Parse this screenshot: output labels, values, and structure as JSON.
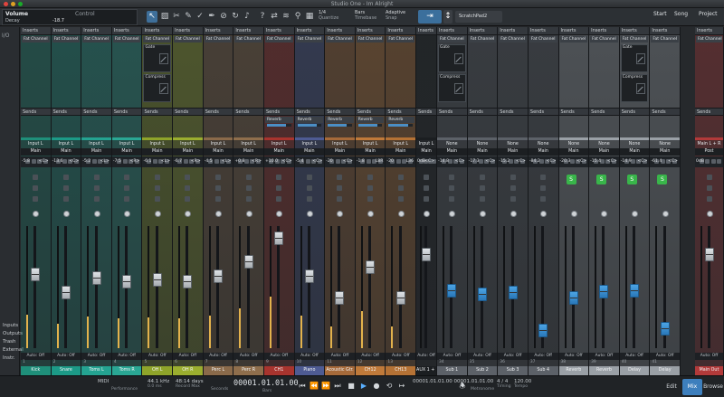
{
  "window": {
    "title": "Studio One - Im Alright"
  },
  "toolbar": {
    "track_name": "Volume",
    "track_sub": "Decay",
    "value": "-18.7",
    "control_label": "Control",
    "quantize_value": "1/4",
    "quantize_label": "Quantize",
    "timebase_value": "Bars",
    "timebase_label": "Timebase",
    "snap_value": "Adaptive",
    "snap_label": "Snap",
    "scratchpad": "ScratchPad2",
    "nav": [
      "Start",
      "Song",
      "Project"
    ],
    "nav_selected": "Song"
  },
  "leftstrip": {
    "io_label": "I/O",
    "menu": [
      "Inputs",
      "Outputs",
      "Trash",
      "External",
      "Instr."
    ]
  },
  "channels": [
    {
      "name": "Kick",
      "num": "1",
      "color": "#1f8f7a",
      "in": "Input L",
      "out": "Main",
      "pan": "<C>",
      "vol": "-5.8",
      "fader": 0.62
    },
    {
      "name": "Snare",
      "num": "2",
      "color": "#1c9a87",
      "in": "Input L",
      "out": "Main",
      "pan": "<C>",
      "vol": "-13.6",
      "fader": 0.45
    },
    {
      "name": "Toms L",
      "num": "3",
      "color": "#24a391",
      "in": "Input L",
      "out": "Main",
      "pan": "<L>",
      "vol": "-5.2",
      "fader": 0.58
    },
    {
      "name": "Toms R",
      "num": "4",
      "color": "#2aa794",
      "in": "Input L",
      "out": "Main",
      "pan": "<R>",
      "vol": "-7.5",
      "fader": 0.55
    },
    {
      "name": "OH L",
      "num": "5",
      "color": "#8fa42a",
      "in": "Input L",
      "out": "Main",
      "pan": "<L>",
      "vol": "-6.1",
      "fader": 0.57
    },
    {
      "name": "OH R",
      "num": "6",
      "color": "#9bae2f",
      "in": "Input L",
      "out": "Main",
      "pan": "<R>",
      "vol": "-6.7",
      "fader": 0.55
    },
    {
      "name": "Perc L",
      "num": "7",
      "color": "#8a6a4a",
      "in": "Input L",
      "out": "Main",
      "pan": "<L>",
      "vol": "-4.5",
      "fader": 0.6
    },
    {
      "name": "Perc R",
      "num": "8",
      "color": "#8f6e4c",
      "in": "Input L",
      "out": "Main",
      "pan": "<R>",
      "vol": "+0.8",
      "fader": 0.73
    },
    {
      "name": "CH1",
      "num": "9",
      "color": "#a8342e",
      "in": "Input L",
      "out": "Main",
      "pan": "<C>",
      "vol": "+10.0",
      "fader": 0.95
    },
    {
      "name": "Piano",
      "num": "10",
      "color": "#4e5b93",
      "in": "Input L",
      "out": "Main",
      "pan": "<C>",
      "vol": "-5.4",
      "fader": 0.6
    },
    {
      "name": "Acoustic Gtr.",
      "num": "11",
      "color": "#a66a3a",
      "in": "Input L",
      "out": "Main",
      "pan": "<C>",
      "vol": "-20",
      "fader": 0.4
    },
    {
      "name": "CH12",
      "num": "12",
      "color": "#c07a3a",
      "in": "Input L",
      "out": "Main",
      "pan": "L8R",
      "vol": "-1.8",
      "fader": 0.68
    },
    {
      "name": "CH13",
      "num": "13",
      "color": "#b57235",
      "in": "Input L",
      "out": "Main",
      "pan": "L36",
      "vol": "-20",
      "fader": 0.4
    },
    {
      "name": "AUX 1 + 2",
      "num": "",
      "color": "#1b1e21",
      "in": "Input L + R",
      "out": "Main",
      "pan": "<C>",
      "vol": "0dB",
      "fader": 0.8
    },
    {
      "name": "Sub 1",
      "num": "34",
      "color": "#5c6168",
      "in": "None",
      "out": "Main",
      "pan": "<C>",
      "vol": "-14.8",
      "fader": 0.47
    },
    {
      "name": "Sub 2",
      "num": "35",
      "color": "#5c6168",
      "in": "None",
      "out": "Main",
      "pan": "<C>",
      "vol": "-17.3",
      "fader": 0.43
    },
    {
      "name": "Sub 3",
      "num": "36",
      "color": "#5c6168",
      "in": "None",
      "out": "Main",
      "pan": "<C>",
      "vol": "-15.2",
      "fader": 0.45
    },
    {
      "name": "Sub 4",
      "num": "37",
      "color": "#5c6168",
      "in": "None",
      "out": "Main",
      "pan": "<C>",
      "vol": "-84.2",
      "fader": 0.1
    },
    {
      "name": "Reverb",
      "num": "38",
      "color": "#9aa0a6",
      "in": "None",
      "out": "Main",
      "pan": "<C>",
      "vol": "-20.3",
      "fader": 0.4
    },
    {
      "name": "Reverb",
      "num": "39",
      "color": "#9aa0a6",
      "in": "None",
      "out": "Main",
      "pan": "<C>",
      "vol": "-15.4",
      "fader": 0.46
    },
    {
      "name": "Delay",
      "num": "40",
      "color": "#9aa0a6",
      "in": "None",
      "out": "Main",
      "pan": "<C>",
      "vol": "-14.9",
      "fader": 0.47
    },
    {
      "name": "Delay",
      "num": "41",
      "color": "#9aa0a6",
      "in": "None",
      "out": "Main",
      "pan": "<C>",
      "vol": "-61.4",
      "fader": 0.12
    },
    {
      "name": "Main Out",
      "num": "",
      "color": "#b23a3a",
      "in": "Main L + R",
      "out": "Post",
      "pan": "",
      "vol": "0dB",
      "fader": 0.8
    }
  ],
  "labels": {
    "inserts": "Inserts",
    "sends": "Sends",
    "fatchannel": "Fat Channel",
    "gate": "Gate",
    "compressor": "Compress",
    "eq": "EQ",
    "filter": "Filter",
    "reverb_send": "Reverb",
    "auto_off": "Auto: Off",
    "s_btn": "S",
    "post": "Post"
  },
  "transport": {
    "midi": "MIDI",
    "perf": "Performance",
    "samplerate": "44.1 kHz",
    "latency": "0.0 ms",
    "record_max": "48:14 days",
    "record_max_label": "Record Max",
    "seconds_label": "Seconds",
    "time": "00001.01.01.00",
    "bars_label": "Bars",
    "loop_l": "00001.01.01.00",
    "loop_r": "00001.01.01.00",
    "sig": "4 / 4",
    "timing_label": "Timing",
    "tempo": "120.00",
    "tempo_label": "Tempo",
    "metronome_label": "Metronome",
    "tabs": [
      "Edit",
      "Mix",
      "Browse"
    ],
    "tab_selected": "Mix"
  }
}
